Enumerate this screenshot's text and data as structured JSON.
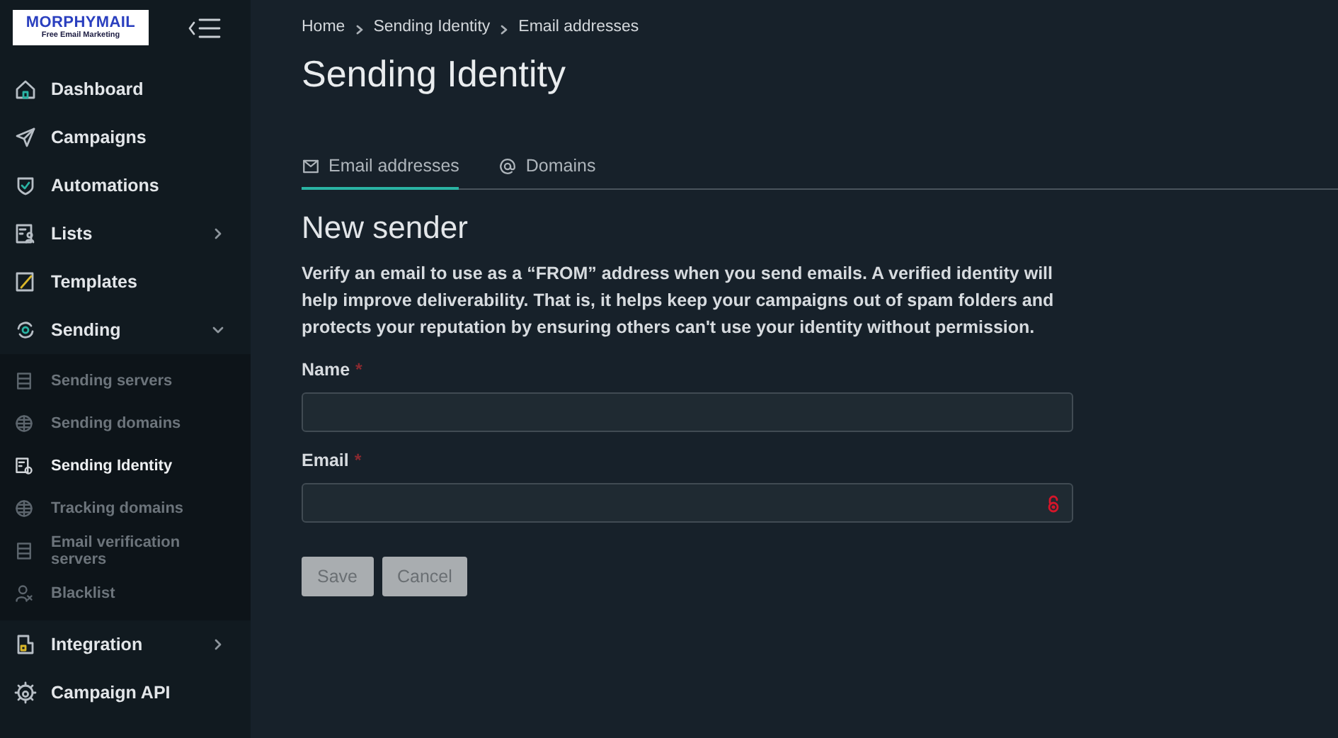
{
  "logo": {
    "title": "MORPHYMAIL",
    "tagline": "Free Email Marketing"
  },
  "sidebar": {
    "items": [
      {
        "label": "Dashboard",
        "kind": "link",
        "selected": false
      },
      {
        "label": "Campaigns",
        "kind": "link",
        "selected": false
      },
      {
        "label": "Automations",
        "kind": "link",
        "selected": false
      },
      {
        "label": "Lists",
        "kind": "group",
        "expanded": false,
        "selected": false
      },
      {
        "label": "Templates",
        "kind": "link",
        "selected": false
      },
      {
        "label": "Sending",
        "kind": "group",
        "expanded": true,
        "selected": false,
        "children": [
          {
            "label": "Sending servers",
            "selected": false
          },
          {
            "label": "Sending domains",
            "selected": false
          },
          {
            "label": "Sending Identity",
            "selected": true
          },
          {
            "label": "Tracking domains",
            "selected": false
          },
          {
            "label": "Email verification servers",
            "selected": false
          },
          {
            "label": "Blacklist",
            "selected": false
          }
        ]
      },
      {
        "label": "Integration",
        "kind": "group",
        "expanded": false,
        "selected": false
      },
      {
        "label": "Campaign API",
        "kind": "link",
        "selected": false
      }
    ]
  },
  "breadcrumb": [
    "Home",
    "Sending Identity",
    "Email addresses"
  ],
  "title": "Sending Identity",
  "tabs": [
    {
      "label": "Email addresses",
      "selected": true
    },
    {
      "label": "Domains",
      "selected": false
    }
  ],
  "form": {
    "heading": "New sender",
    "description": "Verify an email to use as a “FROM” address when you send emails. A verified identity will help improve deliverability. That is, it helps keep your campaigns out of spam folders and protects your reputation by ensuring others can't use your identity without permission.",
    "fields": [
      {
        "label": "Name",
        "required": "*",
        "kind": "text"
      },
      {
        "label": "Email",
        "required": "*",
        "kind": "locked"
      }
    ],
    "buttons": [
      {
        "label": "Save",
        "disabled": true
      },
      {
        "label": "Cancel",
        "disabled": true
      }
    ]
  }
}
